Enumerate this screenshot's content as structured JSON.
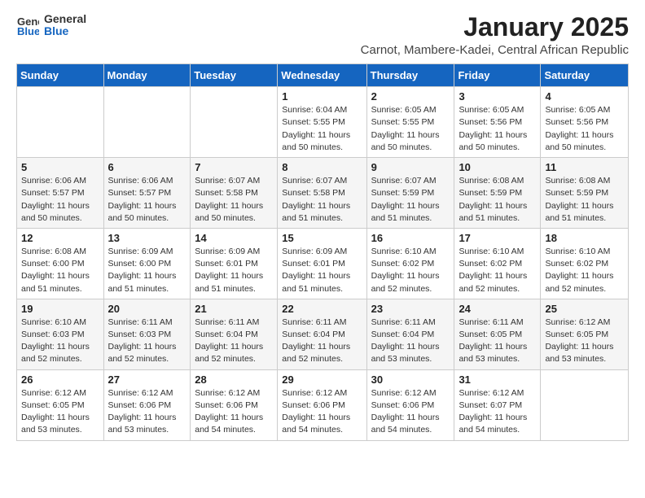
{
  "header": {
    "logo_general": "General",
    "logo_blue": "Blue",
    "month": "January 2025",
    "location": "Carnot, Mambere-Kadei, Central African Republic"
  },
  "days_of_week": [
    "Sunday",
    "Monday",
    "Tuesday",
    "Wednesday",
    "Thursday",
    "Friday",
    "Saturday"
  ],
  "weeks": [
    [
      {
        "day": "",
        "info": ""
      },
      {
        "day": "",
        "info": ""
      },
      {
        "day": "",
        "info": ""
      },
      {
        "day": "1",
        "info": "Sunrise: 6:04 AM\nSunset: 5:55 PM\nDaylight: 11 hours\nand 50 minutes."
      },
      {
        "day": "2",
        "info": "Sunrise: 6:05 AM\nSunset: 5:55 PM\nDaylight: 11 hours\nand 50 minutes."
      },
      {
        "day": "3",
        "info": "Sunrise: 6:05 AM\nSunset: 5:56 PM\nDaylight: 11 hours\nand 50 minutes."
      },
      {
        "day": "4",
        "info": "Sunrise: 6:05 AM\nSunset: 5:56 PM\nDaylight: 11 hours\nand 50 minutes."
      }
    ],
    [
      {
        "day": "5",
        "info": "Sunrise: 6:06 AM\nSunset: 5:57 PM\nDaylight: 11 hours\nand 50 minutes."
      },
      {
        "day": "6",
        "info": "Sunrise: 6:06 AM\nSunset: 5:57 PM\nDaylight: 11 hours\nand 50 minutes."
      },
      {
        "day": "7",
        "info": "Sunrise: 6:07 AM\nSunset: 5:58 PM\nDaylight: 11 hours\nand 50 minutes."
      },
      {
        "day": "8",
        "info": "Sunrise: 6:07 AM\nSunset: 5:58 PM\nDaylight: 11 hours\nand 51 minutes."
      },
      {
        "day": "9",
        "info": "Sunrise: 6:07 AM\nSunset: 5:59 PM\nDaylight: 11 hours\nand 51 minutes."
      },
      {
        "day": "10",
        "info": "Sunrise: 6:08 AM\nSunset: 5:59 PM\nDaylight: 11 hours\nand 51 minutes."
      },
      {
        "day": "11",
        "info": "Sunrise: 6:08 AM\nSunset: 5:59 PM\nDaylight: 11 hours\nand 51 minutes."
      }
    ],
    [
      {
        "day": "12",
        "info": "Sunrise: 6:08 AM\nSunset: 6:00 PM\nDaylight: 11 hours\nand 51 minutes."
      },
      {
        "day": "13",
        "info": "Sunrise: 6:09 AM\nSunset: 6:00 PM\nDaylight: 11 hours\nand 51 minutes."
      },
      {
        "day": "14",
        "info": "Sunrise: 6:09 AM\nSunset: 6:01 PM\nDaylight: 11 hours\nand 51 minutes."
      },
      {
        "day": "15",
        "info": "Sunrise: 6:09 AM\nSunset: 6:01 PM\nDaylight: 11 hours\nand 51 minutes."
      },
      {
        "day": "16",
        "info": "Sunrise: 6:10 AM\nSunset: 6:02 PM\nDaylight: 11 hours\nand 52 minutes."
      },
      {
        "day": "17",
        "info": "Sunrise: 6:10 AM\nSunset: 6:02 PM\nDaylight: 11 hours\nand 52 minutes."
      },
      {
        "day": "18",
        "info": "Sunrise: 6:10 AM\nSunset: 6:02 PM\nDaylight: 11 hours\nand 52 minutes."
      }
    ],
    [
      {
        "day": "19",
        "info": "Sunrise: 6:10 AM\nSunset: 6:03 PM\nDaylight: 11 hours\nand 52 minutes."
      },
      {
        "day": "20",
        "info": "Sunrise: 6:11 AM\nSunset: 6:03 PM\nDaylight: 11 hours\nand 52 minutes."
      },
      {
        "day": "21",
        "info": "Sunrise: 6:11 AM\nSunset: 6:04 PM\nDaylight: 11 hours\nand 52 minutes."
      },
      {
        "day": "22",
        "info": "Sunrise: 6:11 AM\nSunset: 6:04 PM\nDaylight: 11 hours\nand 52 minutes."
      },
      {
        "day": "23",
        "info": "Sunrise: 6:11 AM\nSunset: 6:04 PM\nDaylight: 11 hours\nand 53 minutes."
      },
      {
        "day": "24",
        "info": "Sunrise: 6:11 AM\nSunset: 6:05 PM\nDaylight: 11 hours\nand 53 minutes."
      },
      {
        "day": "25",
        "info": "Sunrise: 6:12 AM\nSunset: 6:05 PM\nDaylight: 11 hours\nand 53 minutes."
      }
    ],
    [
      {
        "day": "26",
        "info": "Sunrise: 6:12 AM\nSunset: 6:05 PM\nDaylight: 11 hours\nand 53 minutes."
      },
      {
        "day": "27",
        "info": "Sunrise: 6:12 AM\nSunset: 6:06 PM\nDaylight: 11 hours\nand 53 minutes."
      },
      {
        "day": "28",
        "info": "Sunrise: 6:12 AM\nSunset: 6:06 PM\nDaylight: 11 hours\nand 54 minutes."
      },
      {
        "day": "29",
        "info": "Sunrise: 6:12 AM\nSunset: 6:06 PM\nDaylight: 11 hours\nand 54 minutes."
      },
      {
        "day": "30",
        "info": "Sunrise: 6:12 AM\nSunset: 6:06 PM\nDaylight: 11 hours\nand 54 minutes."
      },
      {
        "day": "31",
        "info": "Sunrise: 6:12 AM\nSunset: 6:07 PM\nDaylight: 11 hours\nand 54 minutes."
      },
      {
        "day": "",
        "info": ""
      }
    ]
  ]
}
